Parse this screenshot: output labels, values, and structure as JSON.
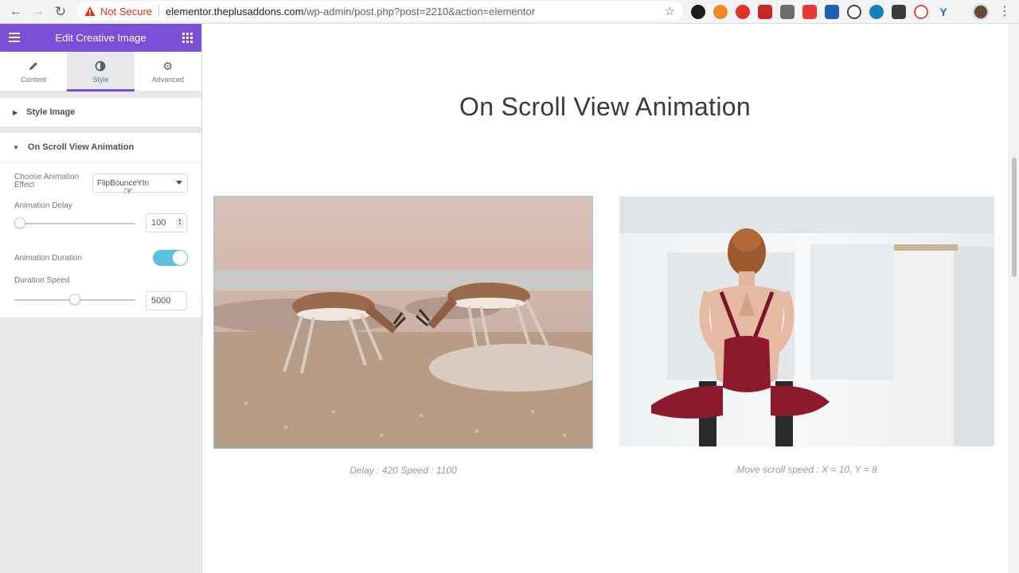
{
  "browser": {
    "security_label": "Not Secure",
    "url_host": "elementor.theplusaddons.com",
    "url_path": "/wp-admin/post.php?post=2210&action=elementor"
  },
  "panel": {
    "title": "Edit Creative Image",
    "tabs": [
      {
        "label": "Content",
        "icon": "pencil-icon"
      },
      {
        "label": "Style",
        "icon": "contrast-icon"
      },
      {
        "label": "Advanced",
        "icon": "gear-icon"
      }
    ],
    "sections": {
      "style_image": "Style Image",
      "on_scroll": "On Scroll View Animation"
    },
    "controls": {
      "effect_label": "Choose Animation Effect",
      "effect_value": "FlipBounceYIn",
      "delay_label": "Animation Delay",
      "delay_value": "100",
      "delay_fraction": 0.02,
      "duration_label": "Animation Duration",
      "duration_enabled": true,
      "speed_label": "Duration Speed",
      "speed_value": "5000",
      "speed_fraction": 0.5
    }
  },
  "canvas": {
    "heading": "On Scroll View Animation",
    "images": [
      {
        "alt": "springboks-fighting-image",
        "caption": "Delay : 420 Speed : 1100"
      },
      {
        "alt": "yoga-woman-image",
        "caption": "Move scroll speed : X = 10, Y = 8"
      }
    ]
  },
  "colors": {
    "accent": "#7b4fd8",
    "toggle_on": "#5bc0de",
    "not_secure": "#d93025"
  }
}
